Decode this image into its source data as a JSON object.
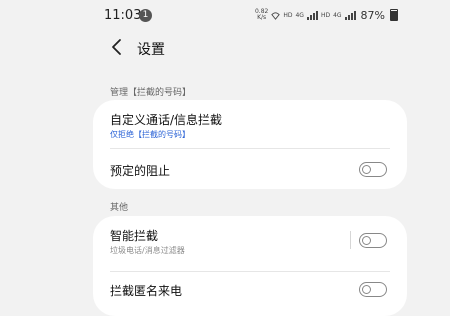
{
  "status_bar": {
    "time": "11:03",
    "notification_badge": "1",
    "net_speed_value": "0.82",
    "net_speed_unit": "K/s",
    "hd_label_1": "HD",
    "lte_label_1": "4G",
    "hd_label_2": "HD",
    "lte_label_2": "4G",
    "battery_percent": "87%",
    "battery_level": 0.87
  },
  "header": {
    "title": "设置"
  },
  "sections": {
    "blocked_numbers_label": "管理【拦截的号码】",
    "other_label": "其他"
  },
  "card1": {
    "row1_title": "自定义通话/信息拦截",
    "row1_sub": "仅拒绝【拦截的号码】",
    "row2_title": "预定的阻止",
    "row2_toggle": false
  },
  "card2": {
    "row1_title": "智能拦截",
    "row1_sub": "垃圾电话/消息过滤器",
    "row1_toggle": false,
    "row2_title": "拦截匿名来电",
    "row2_toggle": false
  },
  "colors": {
    "accent_blue": "#2a62d6",
    "subtitle_gray": "#8a8a8a",
    "background": "#f2f2f2"
  }
}
